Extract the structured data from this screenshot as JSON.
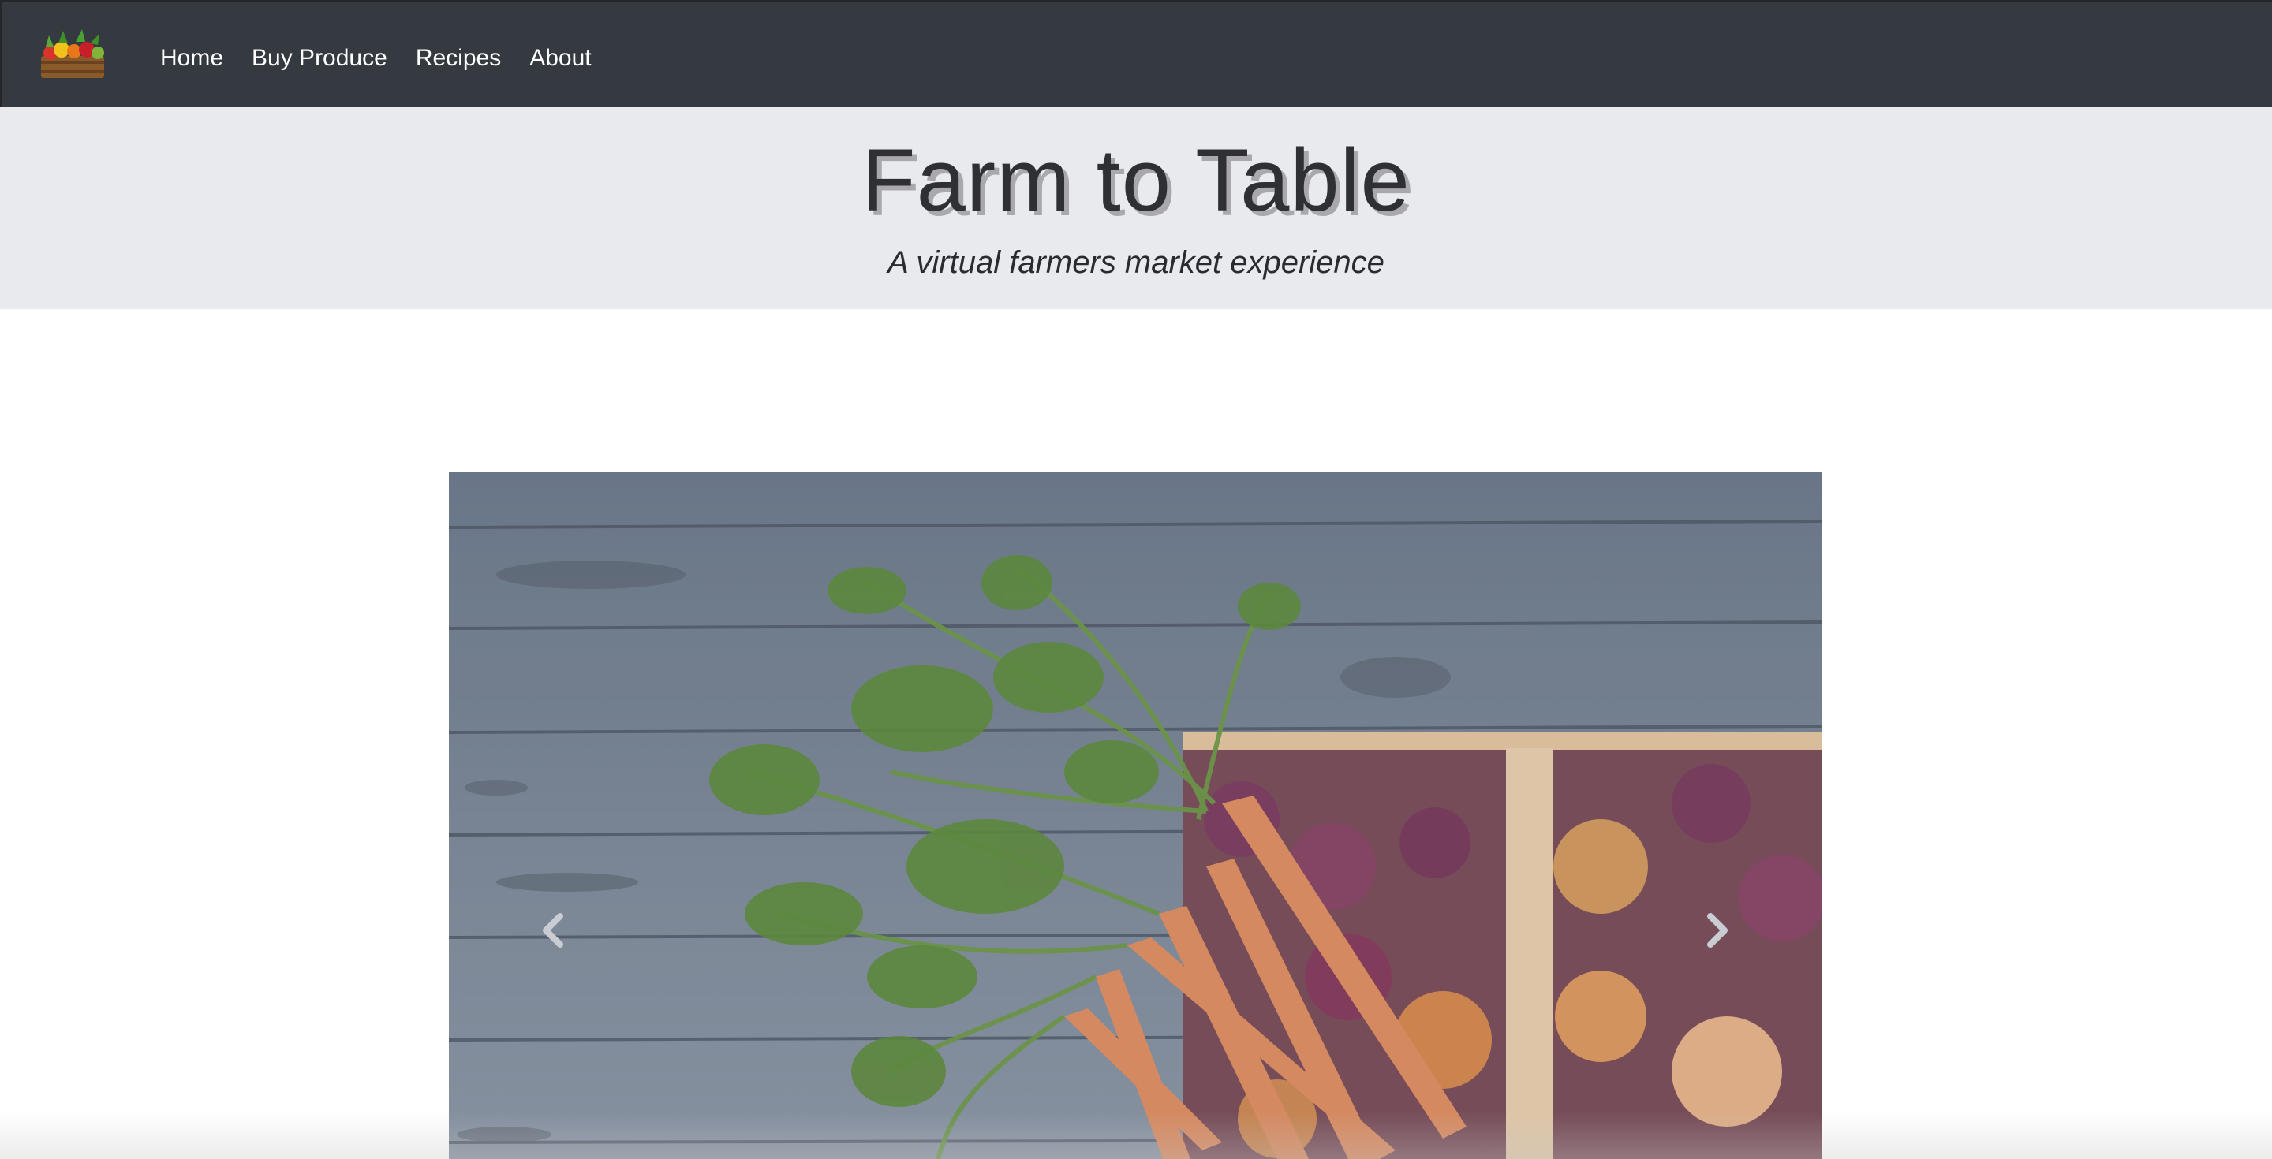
{
  "navbar": {
    "logo_icon": "produce-crate-icon",
    "links": [
      {
        "label": "Home"
      },
      {
        "label": "Buy Produce"
      },
      {
        "label": "Recipes"
      },
      {
        "label": "About"
      }
    ],
    "background": "#343a40"
  },
  "hero": {
    "title": "Farm to Table",
    "subtitle": "A virtual farmers market experience",
    "background": "#e9eaee"
  },
  "carousel": {
    "image_alt": "carrots and onions in a basket on wood",
    "prev_icon": "chevron-left-icon",
    "next_icon": "chevron-right-icon"
  }
}
